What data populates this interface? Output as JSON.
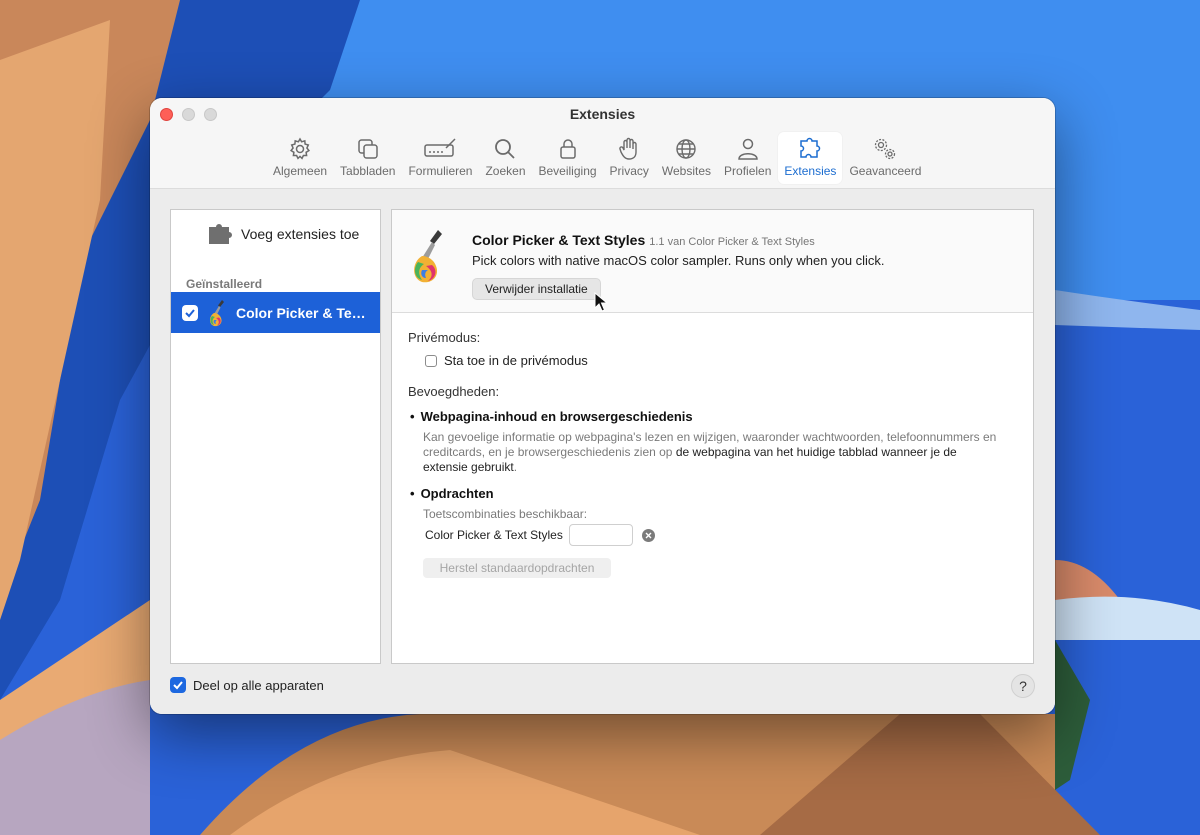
{
  "window": {
    "title": "Extensies"
  },
  "toolbar": {
    "items": [
      {
        "label": "Algemeen",
        "icon": "gear-icon"
      },
      {
        "label": "Tabbladen",
        "icon": "tabs-icon"
      },
      {
        "label": "Formulieren",
        "icon": "forms-icon"
      },
      {
        "label": "Zoeken",
        "icon": "search-icon"
      },
      {
        "label": "Beveiliging",
        "icon": "lock-icon"
      },
      {
        "label": "Privacy",
        "icon": "hand-icon"
      },
      {
        "label": "Websites",
        "icon": "globe-icon"
      },
      {
        "label": "Profielen",
        "icon": "person-icon"
      },
      {
        "label": "Extensies",
        "icon": "puzzle-icon",
        "active": true
      },
      {
        "label": "Geavanceerd",
        "icon": "gears-icon"
      }
    ],
    "accent": "#1c6dd0"
  },
  "sidebar": {
    "add_label": "Voeg extensies toe",
    "installed_heading": "Geïnstalleerd",
    "extension_name": "Color Picker & Text Styles",
    "extension_enabled": true,
    "selected_color": "#1d61d8"
  },
  "detail": {
    "name": "Color Picker & Text Styles",
    "version": "1.1 van Color Picker & Text Styles",
    "description": "Pick colors with native macOS color sampler. Runs only when you click.",
    "uninstall_label": "Verwijder installatie",
    "private_heading": "Privémodus:",
    "private_checkbox_label": "Sta toe in de privémodus",
    "private_checked": false,
    "permissions_heading": "Bevoegdheden:",
    "permission1_title": "Webpagina-inhoud en browsergeschiedenis",
    "permission1_desc_a": "Kan gevoelige informatie op webpagina's lezen en wijzigen, waaronder wachtwoorden, telefoonnummers en creditcards, en je browsergeschiedenis zien op ",
    "permission1_desc_b": "de webpagina van het huidige tabblad wanneer je de extensie gebruikt",
    "permission1_desc_c": ".",
    "permission2_title": "Opdrachten",
    "shortcuts_heading": "Toetscombinaties beschikbaar:",
    "shortcut_name": "Color Picker & Text Styles",
    "shortcut_value": "",
    "reset_label": "Herstel standaardopdrachten"
  },
  "footer": {
    "share_label": "Deel op alle apparaten",
    "share_checked": true,
    "help_label": "?"
  }
}
